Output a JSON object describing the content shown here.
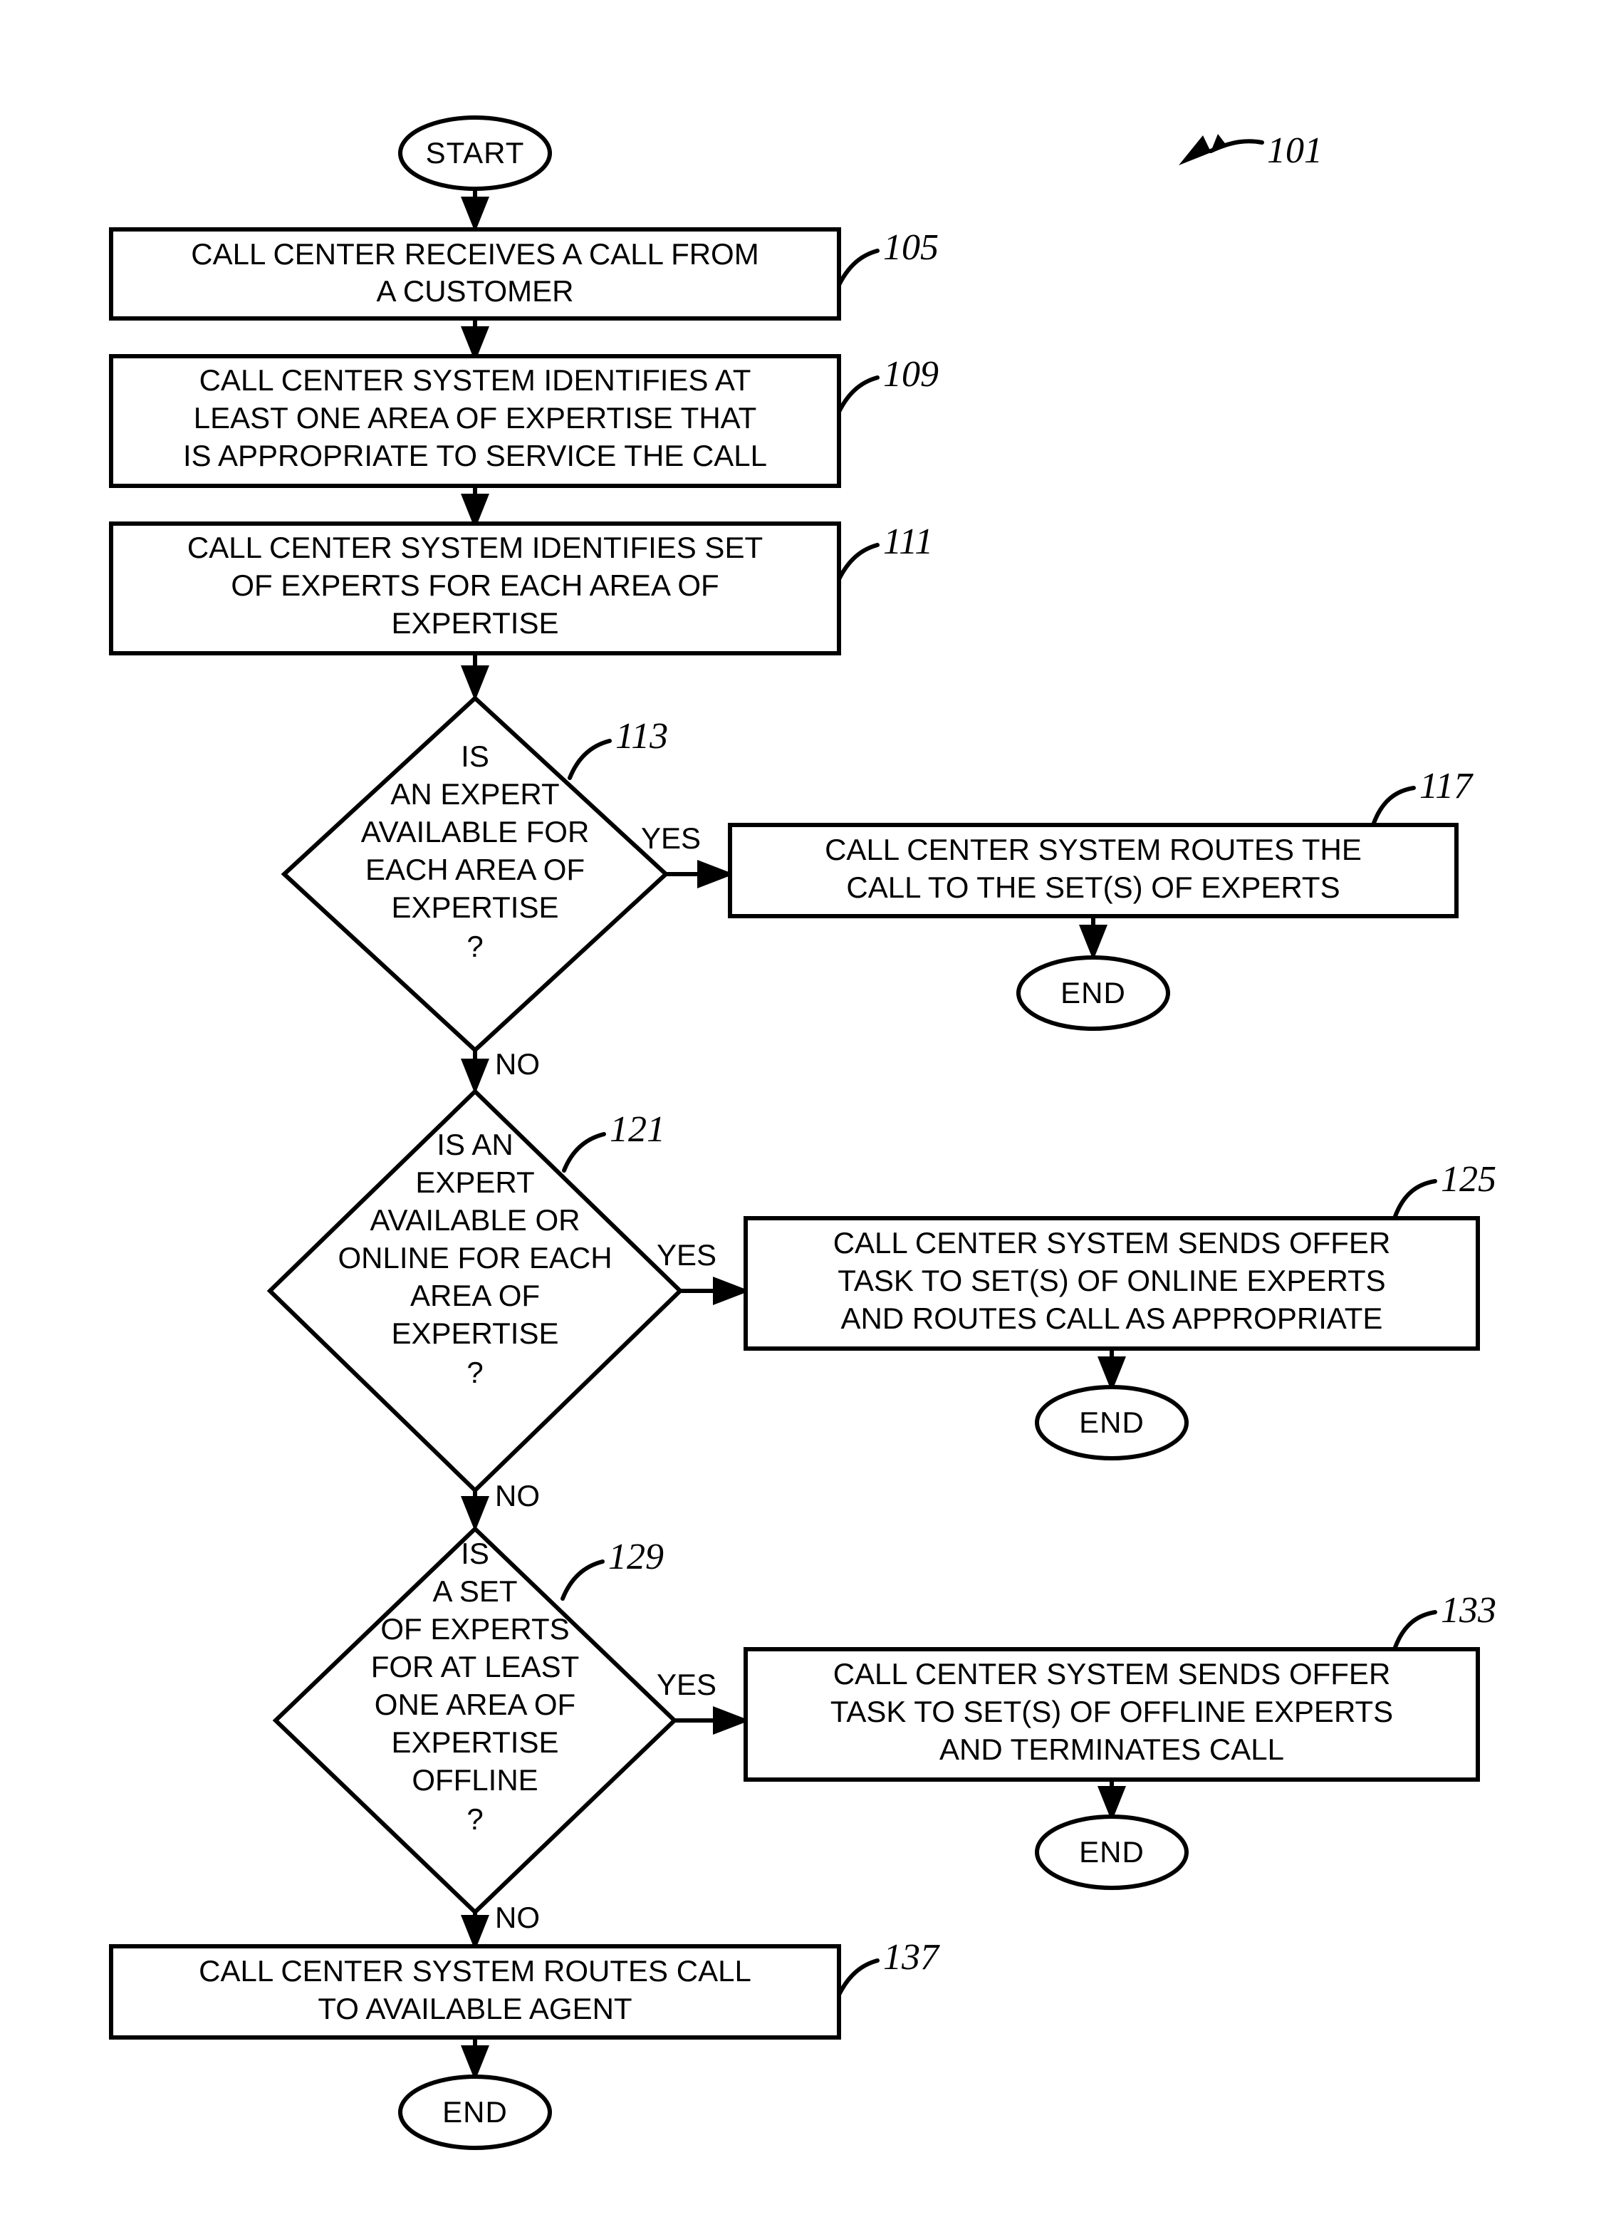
{
  "figure": {
    "figure_ref": "101",
    "title": "Call center expert routing flowchart"
  },
  "terminators": {
    "start_label": "START",
    "end_label_117": "END",
    "end_label_125": "END",
    "end_label_133": "END",
    "end_label_137": "END"
  },
  "branch_labels": {
    "yes_113": "YES",
    "no_113": "NO",
    "yes_121": "YES",
    "no_121": "NO",
    "yes_129": "YES",
    "no_129": "NO"
  },
  "nodes": {
    "n105": {
      "ref": "105",
      "lines": [
        "CALL CENTER RECEIVES A CALL FROM",
        "A CUSTOMER"
      ]
    },
    "n109": {
      "ref": "109",
      "lines": [
        "CALL CENTER SYSTEM IDENTIFIES AT",
        "LEAST ONE AREA OF EXPERTISE THAT",
        "IS APPROPRIATE TO SERVICE THE CALL"
      ]
    },
    "n111": {
      "ref": "111",
      "lines": [
        "CALL CENTER SYSTEM IDENTIFIES SET",
        "OF EXPERTS FOR EACH AREA OF",
        "EXPERTISE"
      ]
    },
    "n113": {
      "ref": "113",
      "lines": [
        "IS",
        "AN EXPERT",
        "AVAILABLE FOR",
        "EACH AREA OF",
        "EXPERTISE",
        "?"
      ]
    },
    "n117": {
      "ref": "117",
      "lines": [
        "CALL CENTER SYSTEM ROUTES THE",
        "CALL TO THE SET(S) OF EXPERTS"
      ]
    },
    "n121": {
      "ref": "121",
      "lines": [
        "IS AN",
        "EXPERT",
        "AVAILABLE OR",
        "ONLINE FOR EACH",
        "AREA OF",
        "EXPERTISE",
        "?"
      ]
    },
    "n125": {
      "ref": "125",
      "lines": [
        "CALL CENTER SYSTEM SENDS OFFER",
        "TASK TO SET(S) OF ONLINE EXPERTS",
        "AND ROUTES CALL AS APPROPRIATE"
      ]
    },
    "n129": {
      "ref": "129",
      "lines": [
        "IS",
        "A SET",
        "OF EXPERTS",
        "FOR AT LEAST",
        "ONE AREA OF",
        "EXPERTISE",
        "OFFLINE",
        "?"
      ]
    },
    "n133": {
      "ref": "133",
      "lines": [
        "CALL CENTER SYSTEM SENDS OFFER",
        "TASK TO SET(S) OF OFFLINE EXPERTS",
        "AND TERMINATES CALL"
      ]
    },
    "n137": {
      "ref": "137",
      "lines": [
        "CALL CENTER SYSTEM ROUTES CALL",
        "TO AVAILABLE AGENT"
      ]
    }
  },
  "colors": {
    "ink": "#000000",
    "paper": "#ffffff"
  }
}
